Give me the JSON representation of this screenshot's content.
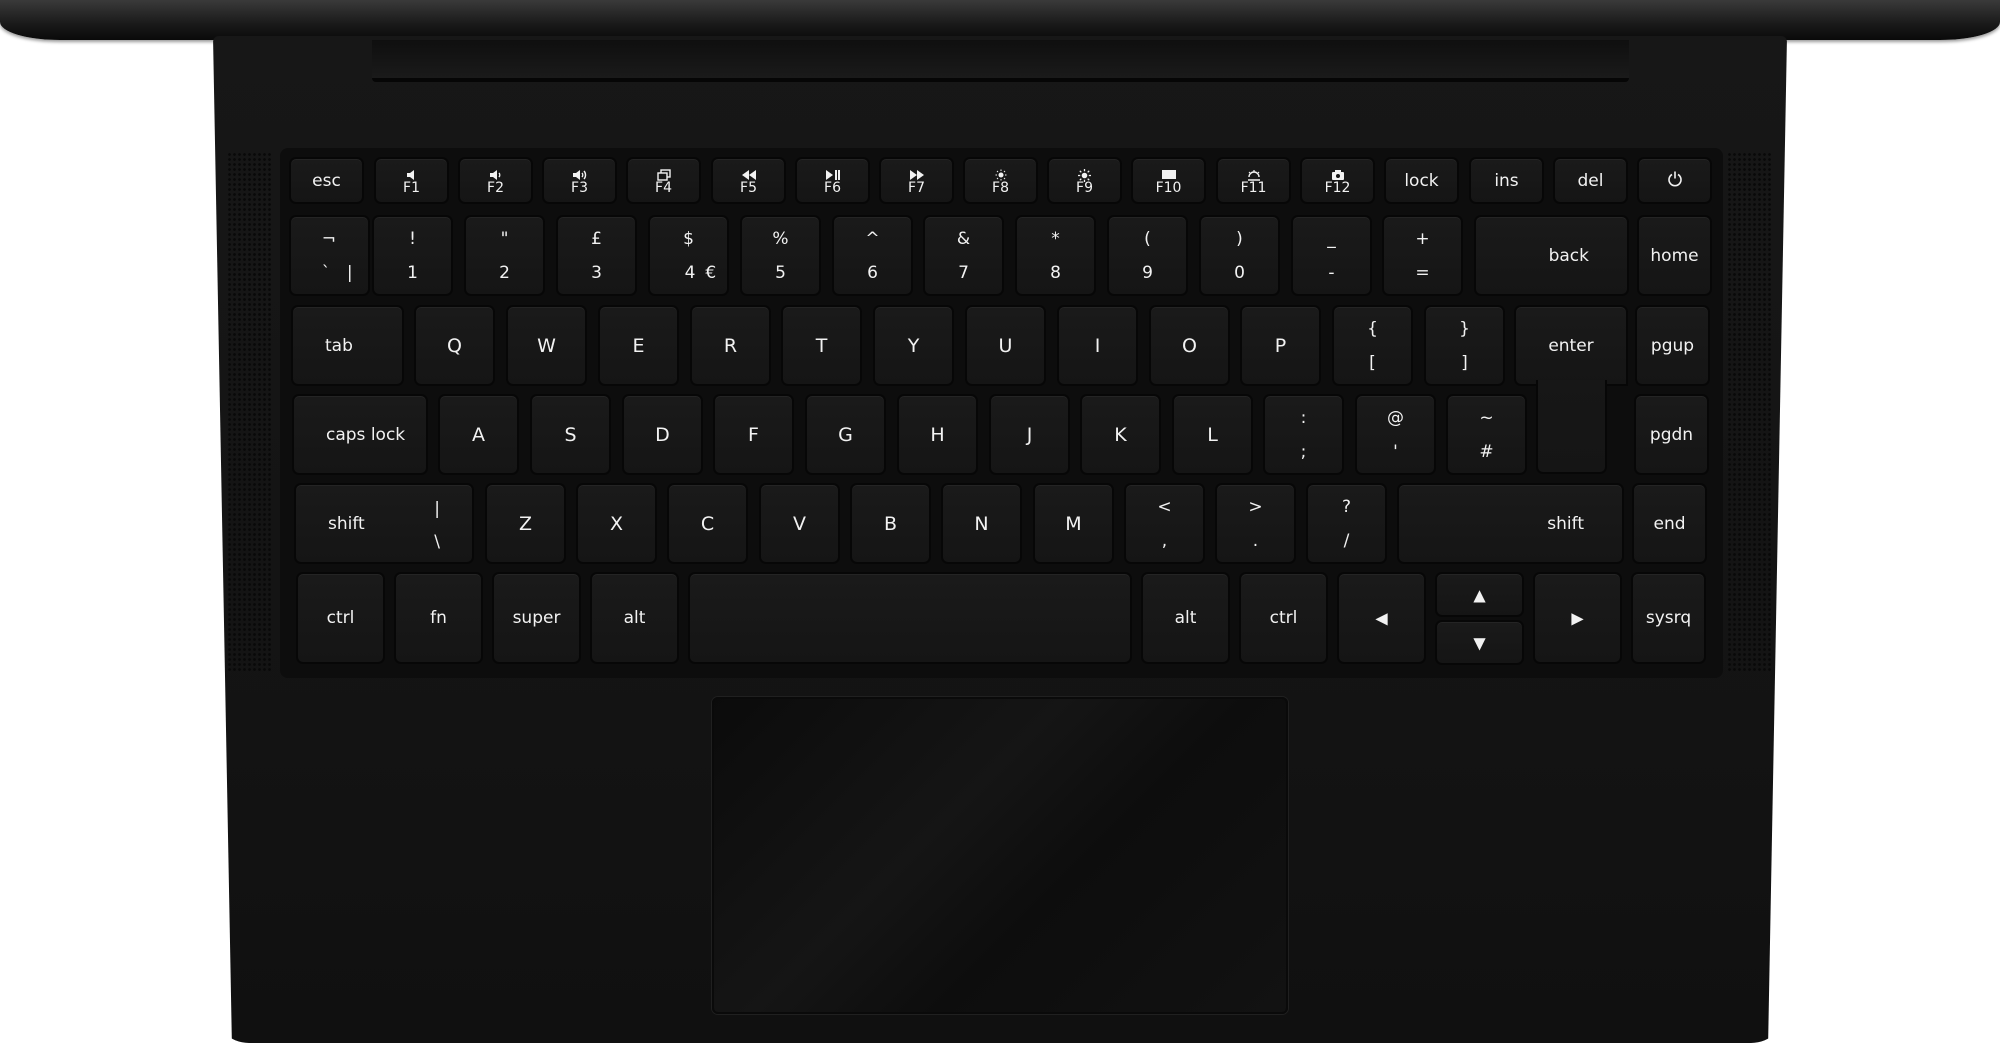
{
  "fn_row": {
    "esc": "esc",
    "f1": "F1",
    "f2": "F2",
    "f3": "F3",
    "f4": "F4",
    "f5": "F5",
    "f6": "F6",
    "f7": "F7",
    "f8": "F8",
    "f9": "F9",
    "f10": "F10",
    "f11": "F11",
    "f12": "F12",
    "lock": "lock",
    "ins": "ins",
    "del": "del",
    "icons": {
      "f1": "mute-icon",
      "f2": "volume-down-icon",
      "f3": "volume-up-icon",
      "f4": "windows-icon",
      "f5": "rewind-icon",
      "f6": "play-pause-icon",
      "f7": "fast-forward-icon",
      "f8": "brightness-down-icon",
      "f9": "brightness-up-icon",
      "f10": "display-icon",
      "f11": "keyboard-backlight-icon",
      "f12": "camera-icon",
      "power": "power-icon"
    }
  },
  "number_row": {
    "grave_top": "¬",
    "grave_bl": "`",
    "grave_br": "|",
    "k1_top": "!",
    "k1": "1",
    "k2_top": "\"",
    "k2": "2",
    "k3_top": "£",
    "k3": "3",
    "k4_top": "$",
    "k4": "4",
    "k4_alt": "€",
    "k5_top": "%",
    "k5": "5",
    "k6_top": "^",
    "k6": "6",
    "k7_top": "&",
    "k7": "7",
    "k8_top": "*",
    "k8": "8",
    "k9_top": "(",
    "k9": "9",
    "k0_top": ")",
    "k0": "0",
    "minus_top": "_",
    "minus": "-",
    "equal_top": "+",
    "equal": "=",
    "back": "back",
    "home": "home"
  },
  "q_row": {
    "tab": "tab",
    "letters": [
      "Q",
      "W",
      "E",
      "R",
      "T",
      "Y",
      "U",
      "I",
      "O",
      "P"
    ],
    "lbrace_top": "{",
    "lbrace": "[",
    "rbrace_top": "}",
    "rbrace": "]",
    "enter": "enter",
    "pgup": "pgup"
  },
  "a_row": {
    "caps": "caps lock",
    "letters": [
      "A",
      "S",
      "D",
      "F",
      "G",
      "H",
      "J",
      "K",
      "L"
    ],
    "semi_top": ":",
    "semi": ";",
    "quote_top": "@",
    "quote": "'",
    "hash_top": "~",
    "hash": "#",
    "pgdn": "pgdn"
  },
  "z_row": {
    "shift_left": "shift",
    "pipe_top": "|",
    "pipe": "\\",
    "letters": [
      "Z",
      "X",
      "C",
      "V",
      "B",
      "N",
      "M"
    ],
    "comma_top": "<",
    "comma": ",",
    "period_top": ">",
    "period": ".",
    "slash_top": "?",
    "slash": "/",
    "shift_right": "shift",
    "end": "end"
  },
  "bottom_row": {
    "ctrl_left": "ctrl",
    "fn": "fn",
    "super": "super",
    "alt_left": "alt",
    "alt_right": "alt",
    "ctrl_right": "ctrl",
    "sysrq": "sysrq",
    "arrows": {
      "left": "◀",
      "up": "▲",
      "down": "▼",
      "right": "▶"
    }
  }
}
